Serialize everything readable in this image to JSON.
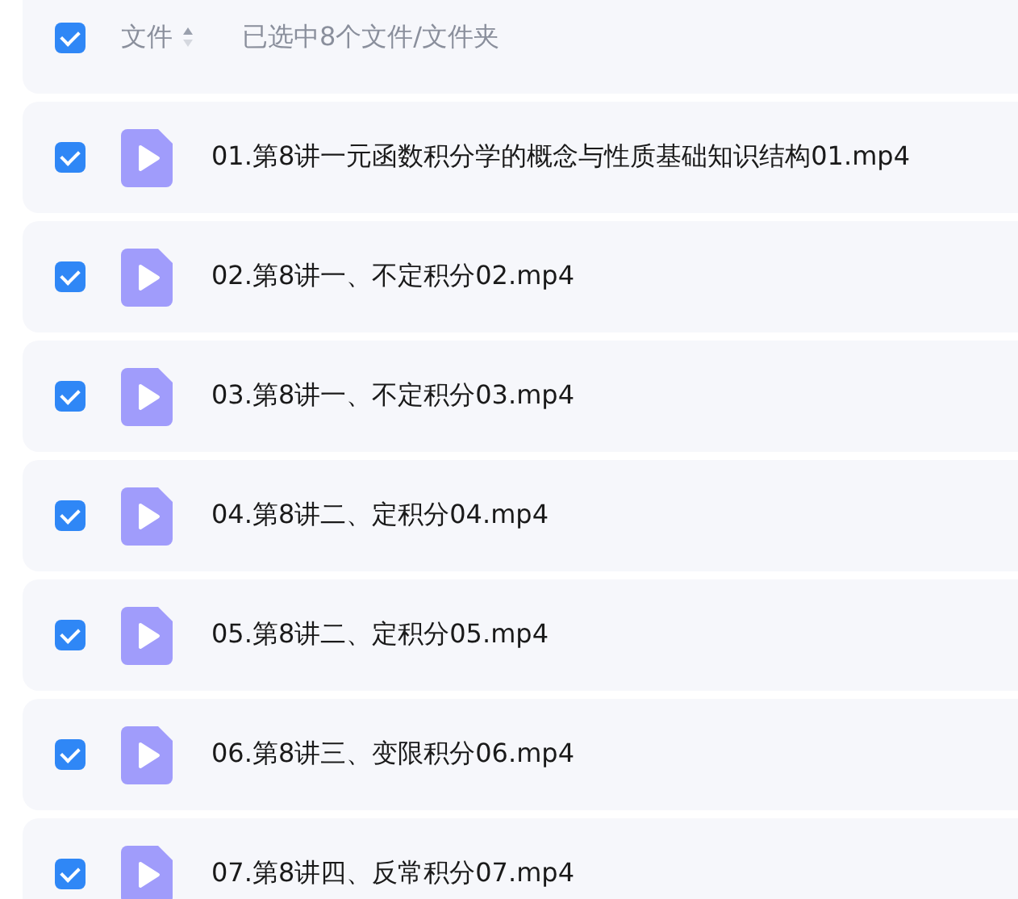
{
  "header": {
    "checked": true,
    "column_label": "文件",
    "selection_text": "已选中8个文件/文件夹"
  },
  "files": [
    {
      "name": "01.第8讲一元函数积分学的概念与性质基础知识结构01.mp4",
      "checked": true
    },
    {
      "name": "02.第8讲一、不定积分02.mp4",
      "checked": true
    },
    {
      "name": "03.第8讲一、不定积分03.mp4",
      "checked": true
    },
    {
      "name": "04.第8讲二、定积分04.mp4",
      "checked": true
    },
    {
      "name": "05.第8讲二、定积分05.mp4",
      "checked": true
    },
    {
      "name": "06.第8讲三、变限积分06.mp4",
      "checked": true
    },
    {
      "name": "07.第8讲四、反常积分07.mp4",
      "checked": true
    }
  ]
}
